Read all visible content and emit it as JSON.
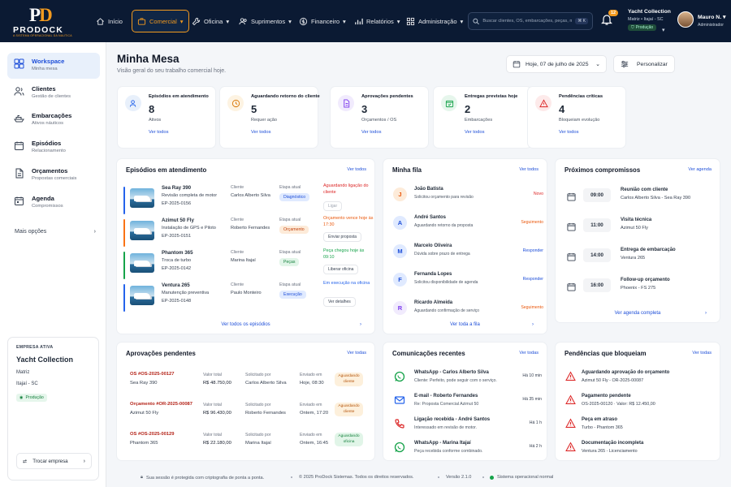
{
  "brand": {
    "mark_p": "P",
    "mark_d": "D",
    "name": "PRODOCK",
    "tagline": "A SISTEMA OPERACIONAL DA NAUTICA"
  },
  "nav": {
    "items": [
      {
        "label": "Início",
        "icon": "home-icon"
      },
      {
        "label": "Comercial",
        "icon": "briefcase-icon",
        "active": true
      },
      {
        "label": "Oficina",
        "icon": "wrench-icon"
      },
      {
        "label": "Suprimentos",
        "icon": "users-icon"
      },
      {
        "label": "Financeiro",
        "icon": "dollar-icon"
      },
      {
        "label": "Relatórios",
        "icon": "chart-icon"
      },
      {
        "label": "Administração",
        "icon": "grid-icon"
      }
    ],
    "caret": "▾"
  },
  "search": {
    "placeholder": "Buscar clientes, OS, embarcações, peças, motores...",
    "shortcut": "⌘ K"
  },
  "notifications": {
    "count": "12"
  },
  "org": {
    "name": "Yacht Collection",
    "location": "Matriz • Itajaí - SC",
    "env": "Produção"
  },
  "user": {
    "name": "Mauro N.",
    "role": "Administrador"
  },
  "sidebar": {
    "items": [
      {
        "label": "Workspace",
        "sub": "Minha mesa",
        "active": true
      },
      {
        "label": "Clientes",
        "sub": "Gestão de clientes"
      },
      {
        "label": "Embarcações",
        "sub": "Ativos náuticos"
      },
      {
        "label": "Episódios",
        "sub": "Relacionamento"
      },
      {
        "label": "Orçamentos",
        "sub": "Propostas comerciais"
      },
      {
        "label": "Agenda",
        "sub": "Compromissos"
      }
    ],
    "more": "Mais opções",
    "company": {
      "kicker": "EMPRESA ATIVA",
      "name": "Yacht Collection",
      "branch": "Matriz",
      "city": "Itajaí  -  SC",
      "badge": "Produção",
      "switch": "Trocar empresa"
    }
  },
  "page": {
    "title": "Minha Mesa",
    "subtitle": "Visão geral do seu trabalho comercial hoje.",
    "date": "Hoje, 07 de julho de 2025",
    "customize": "Personalizar"
  },
  "kpis": [
    {
      "title": "Episódios em atendimento",
      "value": "8",
      "sub": "Ativos",
      "link": "Ver todos",
      "color": "#2563eb",
      "bg": "#e8f0fb"
    },
    {
      "title": "Aguardando retorno do cliente",
      "value": "5",
      "sub": "Requer ação",
      "link": "Ver todos",
      "color": "#d97706",
      "bg": "#fdf3e2"
    },
    {
      "title": "Aprovações pendentes",
      "value": "3",
      "sub": "Orçamentos / OS",
      "link": "Ver todos",
      "color": "#7c3aed",
      "bg": "#f1ebfd"
    },
    {
      "title": "Entregas previstas hoje",
      "value": "2",
      "sub": "Embarcações",
      "link": "Ver todos",
      "color": "#16a34a",
      "bg": "#e6f6ec"
    },
    {
      "title": "Pendências críticas",
      "value": "4",
      "sub": "Bloqueiam evolução",
      "link": "Ver todos",
      "color": "#dc2626",
      "bg": "#fdeaea"
    }
  ],
  "episodes": {
    "title": "Episódios em atendimento",
    "link": "Ver todos",
    "footer": "Ver todos os episódios",
    "client_label": "Cliente",
    "stage_label": "Etapa atual",
    "rows": [
      {
        "name": "Sea Ray 390",
        "desc": "Revisão completa de motor",
        "code": "EP-2025-0156",
        "client": "Carlos Alberto Silva",
        "stage": "Diagnóstico",
        "stage_color": "#1d4ed8",
        "stage_bg": "#e0eaff",
        "status": "Aguardando ligação do cliente",
        "status_color": "#dc2626",
        "action": "Ligar",
        "bar": "#2563eb"
      },
      {
        "name": "Azimut 50 Fly",
        "desc": "Instalação de GPS e Piloto",
        "code": "EP-2025-0151",
        "client": "Roberto Fernandes",
        "stage": "Orçamento",
        "stage_color": "#c2410c",
        "stage_bg": "#fdebd9",
        "status": "Orçamento vence hoje às 17:30",
        "status_color": "#ea580c",
        "action": "Enviar proposta",
        "bar": "#f97316"
      },
      {
        "name": "Phantom 365",
        "desc": "Troca de turbo",
        "code": "EP-2025-0142",
        "client": "Marina Itajaí",
        "stage": "Peças",
        "stage_color": "#15803d",
        "stage_bg": "#e1f5e8",
        "status": "Peça chegou hoje às 09:10",
        "status_color": "#16a34a",
        "action": "Liberar oficina",
        "bar": "#16a34a"
      },
      {
        "name": "Ventura 265",
        "desc": "Manutenção preventiva",
        "code": "EP-2025-0148",
        "client": "Paulo Monteiro",
        "stage": "Execução",
        "stage_color": "#1d4ed8",
        "stage_bg": "#e0eaff",
        "status": "Em execução na oficina",
        "status_color": "#2563eb",
        "action": "Ver detalhes",
        "bar": "#2563eb"
      }
    ]
  },
  "queue": {
    "title": "Minha fila",
    "link": "Ver todos",
    "footer": "Ver toda a fila",
    "rows": [
      {
        "initial": "J",
        "name": "João Batista",
        "desc": "Solicitou orçamento para revisão",
        "tag": "Novo",
        "tag_color": "#dc2626",
        "av_color": "#ea580c",
        "av_bg": "#fdebd9"
      },
      {
        "initial": "A",
        "name": "André Santos",
        "desc": "Aguardando retorno da proposta",
        "tag": "Seguimento",
        "tag_color": "#ea580c",
        "av_color": "#1d4ed8",
        "av_bg": "#e0eaff"
      },
      {
        "initial": "M",
        "name": "Marcelo Oliveira",
        "desc": "Dúvida sobre prazo de entrega",
        "tag": "Responder",
        "tag_color": "#1d4ed8",
        "av_color": "#1d4ed8",
        "av_bg": "#e0eaff"
      },
      {
        "initial": "F",
        "name": "Fernanda Lopes",
        "desc": "Solicitou disponibilidade de agenda",
        "tag": "Responder",
        "tag_color": "#1d4ed8",
        "av_color": "#1d4ed8",
        "av_bg": "#e0eaff"
      },
      {
        "initial": "R",
        "name": "Ricardo Almeida",
        "desc": "Aguardando confirmação de serviço",
        "tag": "Seguimento",
        "tag_color": "#ea580c",
        "av_color": "#7c3aed",
        "av_bg": "#f1ebfd"
      }
    ]
  },
  "agenda": {
    "title": "Próximos compromissos",
    "link": "Ver agenda",
    "footer": "Ver agenda completa",
    "rows": [
      {
        "time": "09:00",
        "title": "Reunião com cliente",
        "sub": "Carlos Alberto Silva - Sea Ray 390"
      },
      {
        "time": "11:00",
        "title": "Visita técnica",
        "sub": "Azimut 50 Fly"
      },
      {
        "time": "14:00",
        "title": "Entrega de embarcação",
        "sub": "Ventura 265"
      },
      {
        "time": "16:00",
        "title": "Follow-up orçamento",
        "sub": "Phoenix - FS 275"
      }
    ]
  },
  "approvals": {
    "title": "Aprovações pendentes",
    "link": "Ver todas",
    "value_label": "Valor total",
    "by_label": "Solicitado por",
    "sent_label": "Enviado em",
    "rows": [
      {
        "code": "OS #OS-2025-00127",
        "boat": "Sea Ray 390",
        "value": "R$ 48.750,00",
        "by": "Carlos Alberto Silva",
        "when": "Hoje, 08:30",
        "tag": "Aguardando cliente",
        "tag_color": "#b45309",
        "tag_bg": "#fdf0dc"
      },
      {
        "code": "Orçamento #OR-2025-00087",
        "boat": "Azimut 50 Fly",
        "value": "R$ 96.430,00",
        "by": "Roberto Fernandes",
        "when": "Ontem, 17:20",
        "tag": "Aguardando cliente",
        "tag_color": "#b45309",
        "tag_bg": "#fdf0dc"
      },
      {
        "code": "OS #OS-2025-00129",
        "boat": "Phantom 365",
        "value": "R$ 22.180,00",
        "by": "Marina Itajaí",
        "when": "Ontem, 16:45",
        "tag": "Aguardando oficina",
        "tag_color": "#15803d",
        "tag_bg": "#e1f5e8"
      }
    ]
  },
  "comms": {
    "title": "Comunicações recentes",
    "link": "Ver todas",
    "rows": [
      {
        "type": "whatsapp-icon",
        "title": "WhatsApp - Carlos Alberto Silva",
        "desc": "Cliente: Perfeito, pode seguir com o serviço.",
        "time": "Há 10 min",
        "color": "#16a34a"
      },
      {
        "type": "email-icon",
        "title": "E-mail - Roberto Fernandes",
        "desc": "Re: Proposta Comercial Azimut 50",
        "time": "Há 35 min",
        "color": "#2563eb"
      },
      {
        "type": "phone-icon",
        "title": "Ligação recebida - André Santos",
        "desc": "Interessado em revisão de motor.",
        "time": "Há 1 h",
        "color": "#dc2626"
      },
      {
        "type": "whatsapp-icon",
        "title": "WhatsApp - Marina Itajaí",
        "desc": "Peça recebida conforme combinado.",
        "time": "Há 2 h",
        "color": "#16a34a"
      }
    ]
  },
  "blockers": {
    "title": "Pendências que bloqueiam",
    "link": "Ver todas",
    "rows": [
      {
        "title": "Aguardando aprovação do orçamento",
        "sub": "Azimut 50 Fly - OR-2025-00087"
      },
      {
        "title": "Pagamento pendente",
        "sub": "OS-2025-00120 · Valor: R$ 12.450,00"
      },
      {
        "title": "Peça em atraso",
        "sub": "Turbo - Phantom 365"
      },
      {
        "title": "Documentação incompleta",
        "sub": "Ventura 265 - Licenciamento"
      }
    ]
  },
  "footer": {
    "secure": "Sua sessão é protegida com criptografia de ponta a ponta.",
    "copyright": "© 2025 ProDock Sistemas. Todos os direitos reservados.",
    "version": "Versão 2.1.0",
    "status": "Sistema operacional normal"
  }
}
